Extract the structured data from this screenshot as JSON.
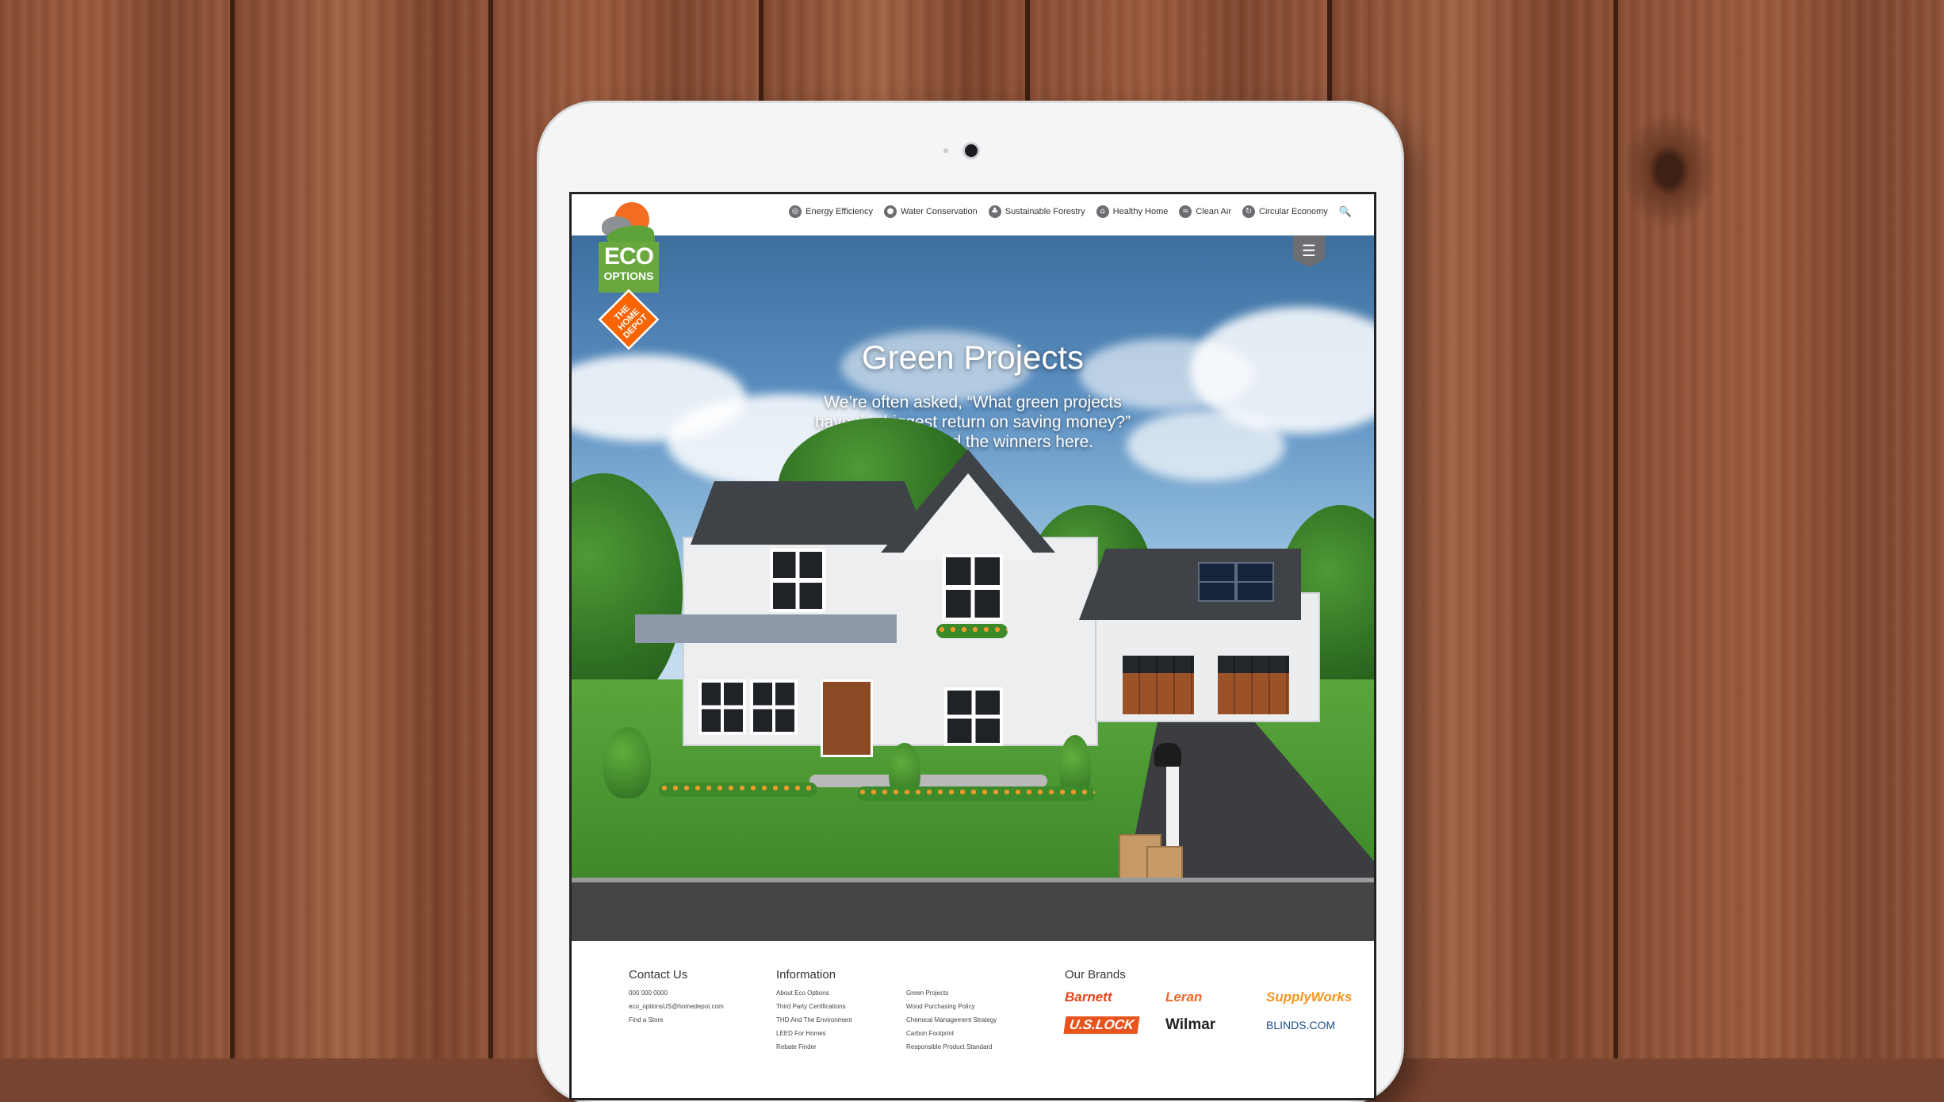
{
  "site": {
    "logo": {
      "eco": "ECO",
      "options": "OPTIONS",
      "home_depot": "THE HOME DEPOT"
    },
    "nav": [
      {
        "label": "Energy Efficiency",
        "icon": "gauge-icon"
      },
      {
        "label": "Water Conservation",
        "icon": "water-drop-icon"
      },
      {
        "label": "Sustainable Forestry",
        "icon": "tree-icon"
      },
      {
        "label": "Healthy Home",
        "icon": "home-icon"
      },
      {
        "label": "Clean Air",
        "icon": "wind-icon"
      },
      {
        "label": "Circular Economy",
        "icon": "cycle-icon"
      }
    ],
    "search_glyph": "🔍",
    "menu_glyph": "☰"
  },
  "hero": {
    "title": "Green Projects",
    "line1": "We’re often asked, “What green projects",
    "line2": "have the biggest return on saving money?”",
    "line3": "We’ve outlined the winners here."
  },
  "footer": {
    "contact": {
      "heading": "Contact Us",
      "phone": "000 000 0000",
      "email": "eco_optionsUS@homedepot.com",
      "store": "Find a Store"
    },
    "information": {
      "heading": "Information",
      "col1": [
        "About Eco Options",
        "Third Party Certifications",
        "THD And The Environment",
        "LEED For Homes",
        "Rebate Finder"
      ],
      "col2": [
        "Green Projects",
        "Wood Purchasing Policy",
        "Chemical Management Strategy",
        "Carbon Footprint",
        "Responsible Product Standard"
      ]
    },
    "brands": {
      "heading": "Our Brands",
      "items": [
        "Barnett",
        "Leran",
        "SupplyWorks",
        "U.S.LOCK",
        "Wilmar",
        "BLINDS.COM"
      ]
    }
  },
  "colors": {
    "eco_green": "#69a83f",
    "thd_orange": "#f96302",
    "nav_icon_gray": "#6d6e71"
  }
}
